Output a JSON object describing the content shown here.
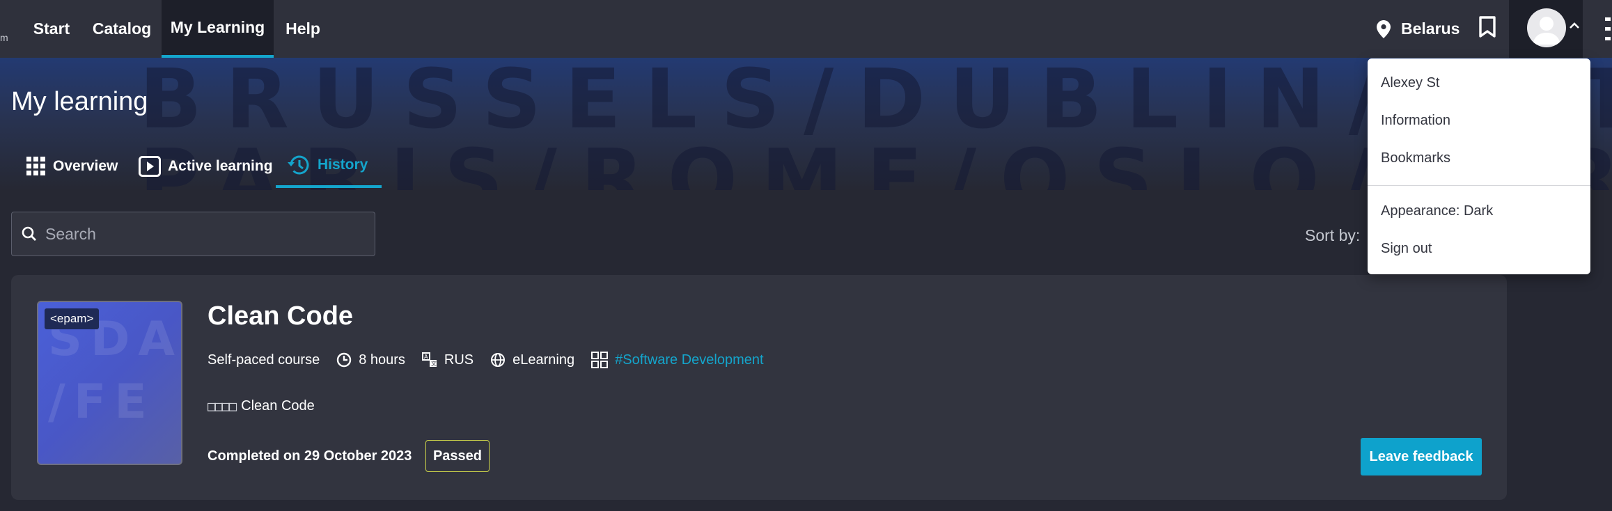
{
  "brand_fragment": "m",
  "nav": {
    "items": [
      {
        "label": "Start"
      },
      {
        "label": "Catalog"
      },
      {
        "label": "My Learning"
      },
      {
        "label": "Help"
      }
    ],
    "active_item": "My Learning",
    "location": "Belarus",
    "icons": {
      "location": "map-pin-icon",
      "bookmark": "bookmark-icon",
      "avatar": "user-avatar",
      "chevron": "chevron-up-icon",
      "more": "kebab-menu-icon"
    }
  },
  "hero": {
    "watermark_line1": "BRUSSELS/DUBLIN/POTSDAM/",
    "watermark_line2": "PARIS/ROME/OSLO/FERH"
  },
  "page": {
    "title": "My learning"
  },
  "tabs": [
    {
      "label": "Overview",
      "icon": "grid-icon"
    },
    {
      "label": "Active learning",
      "icon": "play-icon"
    },
    {
      "label": "History",
      "icon": "history-icon"
    }
  ],
  "active_tab": "History",
  "search": {
    "placeholder": "Search"
  },
  "sort": {
    "label": "Sort by:"
  },
  "course": {
    "logo_text": "<epam>",
    "thumb_watermark1": "SDA",
    "thumb_watermark2": "/FE",
    "title": "Clean Code",
    "meta": {
      "type": "Self-paced course",
      "duration": "8 hours",
      "language": "RUS",
      "format": "eLearning",
      "tag": "#Software Development"
    },
    "description_placeholder": "□□□□",
    "description": "Clean Code",
    "completed": "Completed on 29 October 2023",
    "status": "Passed",
    "feedback_button": "Leave feedback"
  },
  "colors": {
    "accent": "#14a5cc",
    "nav_bg": "#2f313c",
    "page_bg": "#262833",
    "card_bg": "#32343f",
    "badge_border": "#cfd64a"
  },
  "user_menu": {
    "user_name": "Alexey St",
    "items": [
      "Information",
      "Bookmarks"
    ],
    "appearance": "Appearance: Dark",
    "sign_out": "Sign out"
  }
}
